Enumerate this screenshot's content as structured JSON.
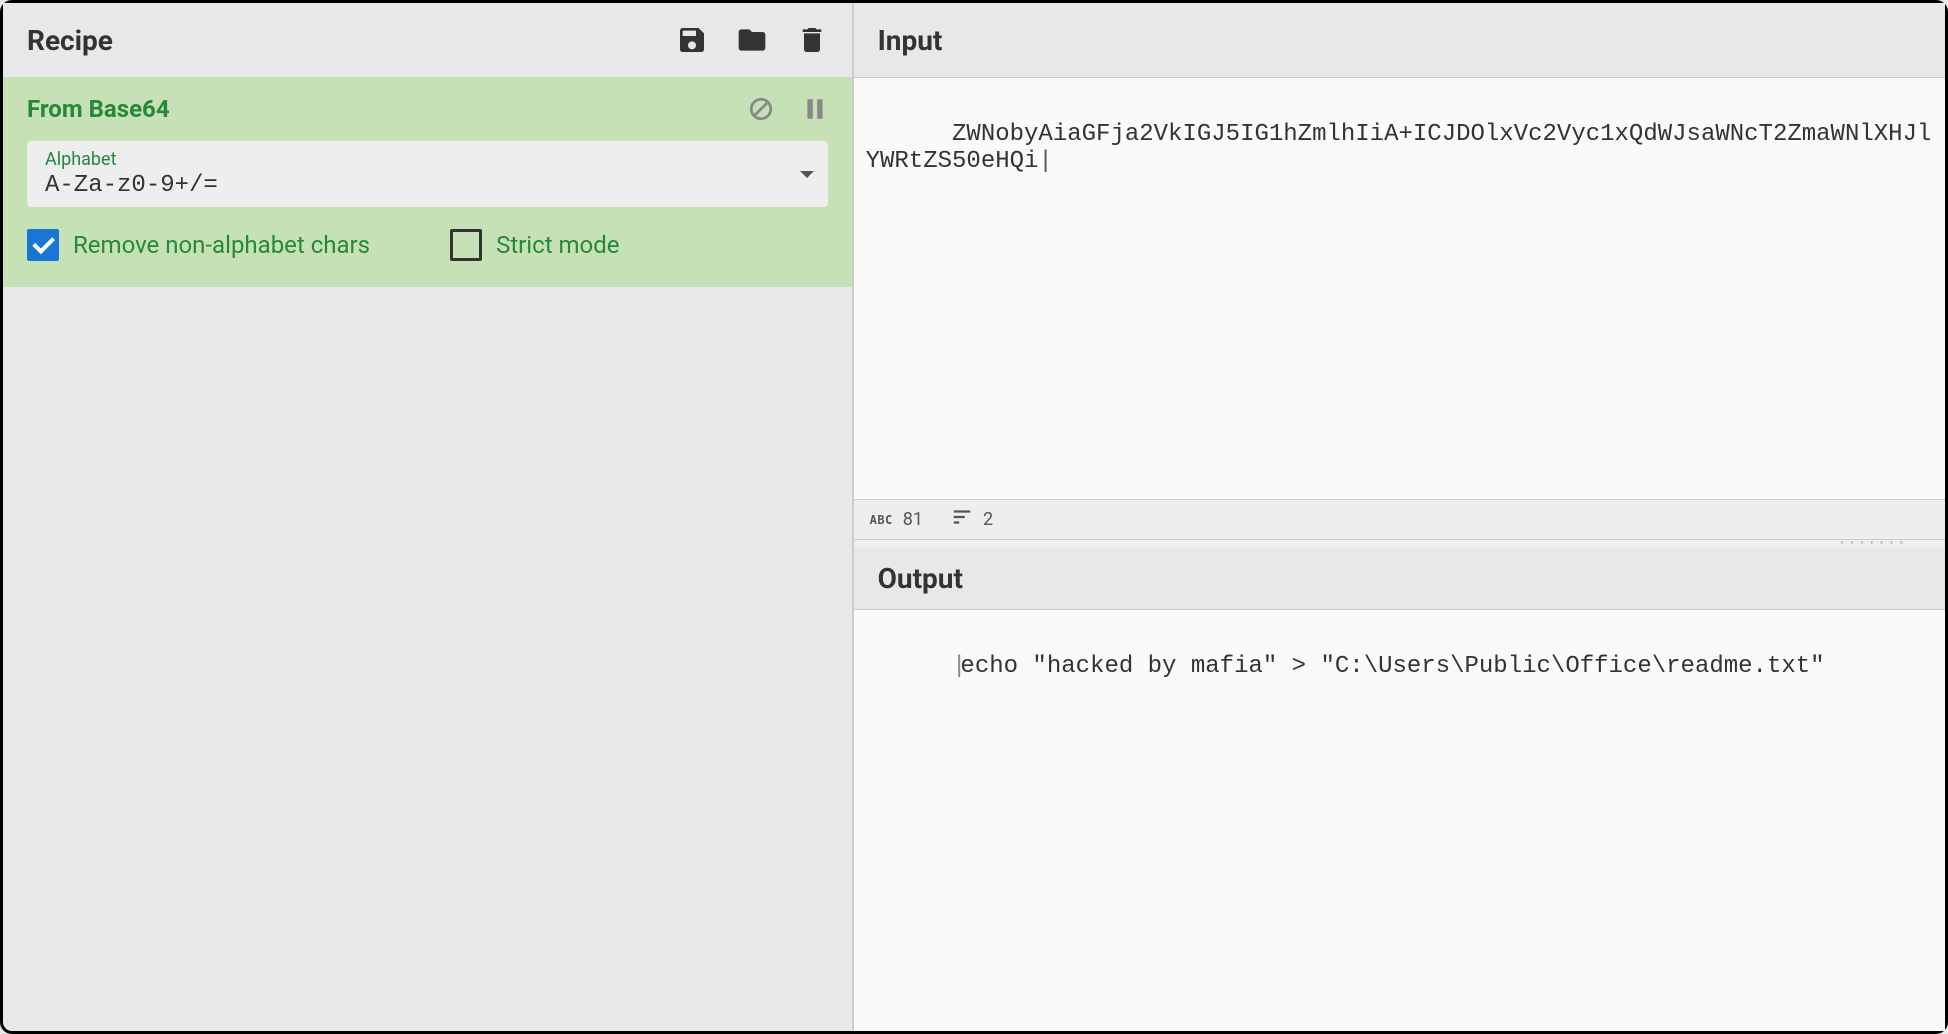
{
  "recipe": {
    "title": "Recipe",
    "operations": [
      {
        "name": "From Base64",
        "alphabet_label": "Alphabet",
        "alphabet_value": "A-Za-z0-9+/=",
        "remove_non_alpha": {
          "label": "Remove non-alphabet chars",
          "checked": true
        },
        "strict_mode": {
          "label": "Strict mode",
          "checked": false
        }
      }
    ]
  },
  "input": {
    "title": "Input",
    "text": "ZWNobyAiaGFja2VkIGJ5IG1hZmlhIiA+ICJDOlxVc2Vyc1xQdWJsaWNcT2ZmaWNlXHJlYWRtZS50eHQi",
    "char_count": "81",
    "line_count": "2"
  },
  "output": {
    "title": "Output",
    "text": "echo \"hacked by mafia\" > \"C:\\Users\\Public\\Office\\readme.txt\""
  }
}
